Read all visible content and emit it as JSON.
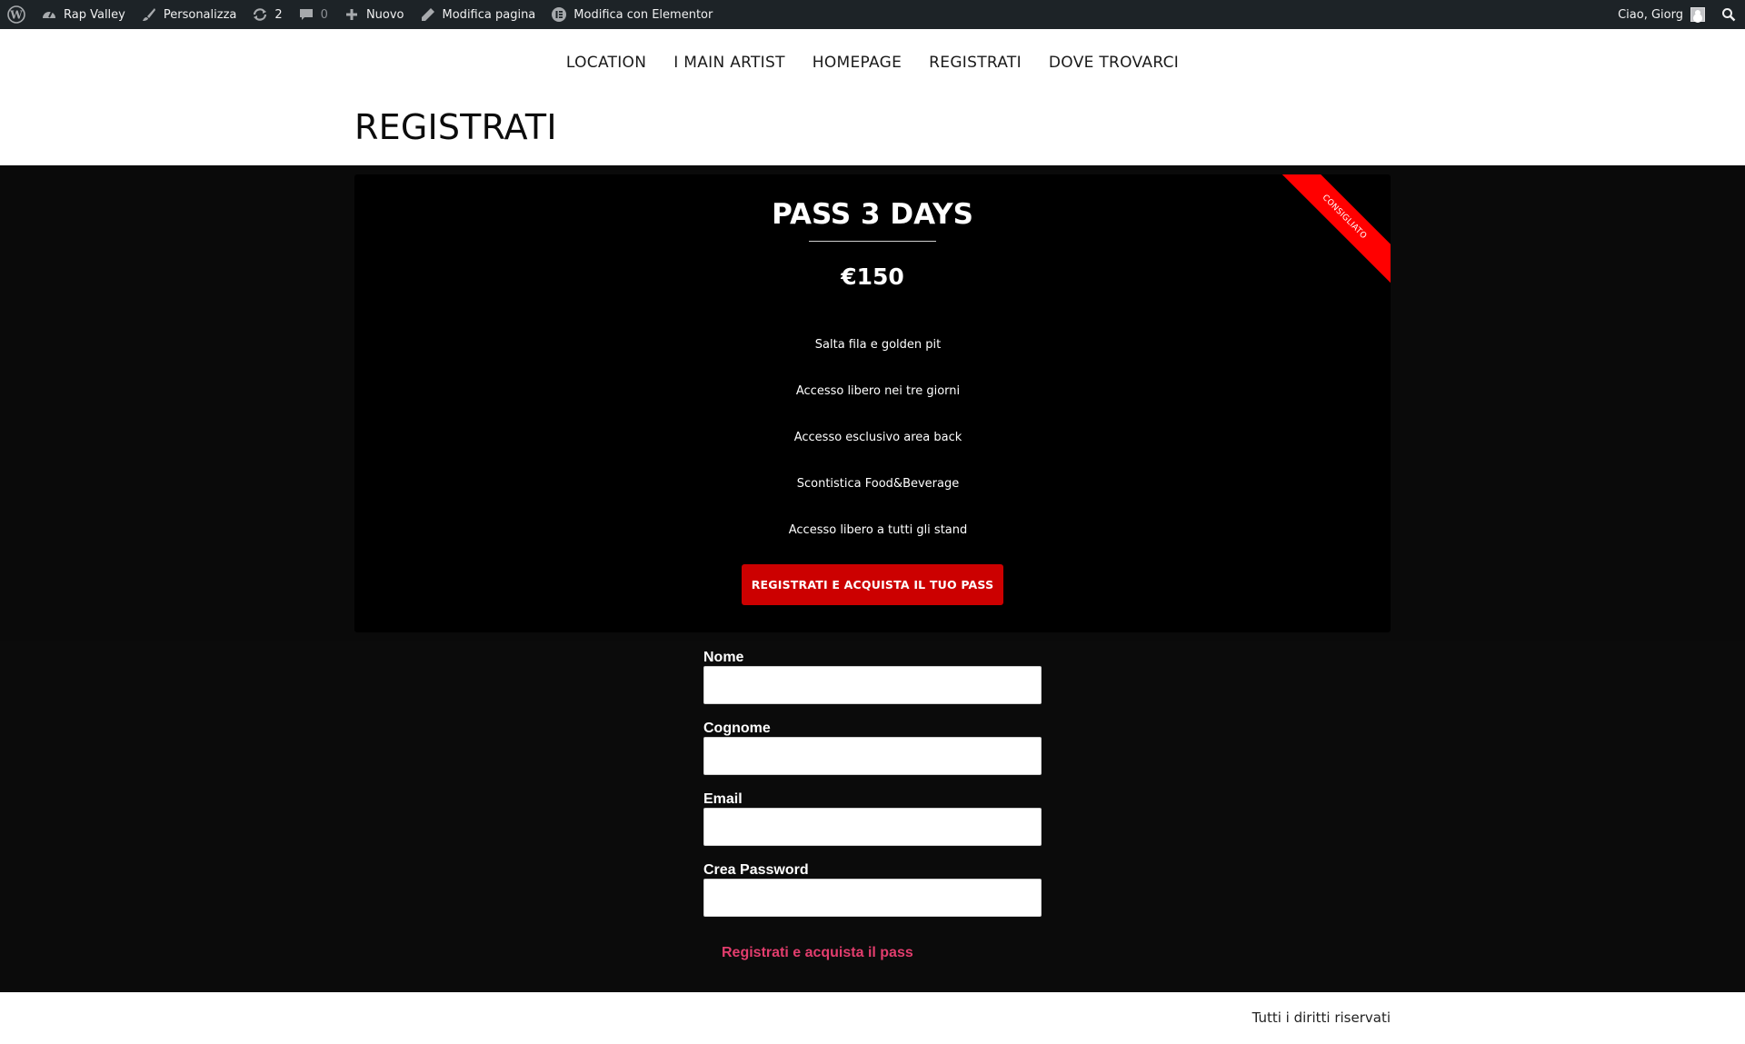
{
  "adminbar": {
    "wp_icon": "wordpress-logo-icon",
    "site_name": "Rap Valley",
    "customize": "Personalizza",
    "updates_count": "2",
    "comments_count": "0",
    "new": "Nuovo",
    "edit_page": "Modifica pagina",
    "edit_elementor": "Modifica con Elementor",
    "greeting": "Ciao, Giorg"
  },
  "nav": {
    "items": [
      "LOCATION",
      "I MAIN ARTIST",
      "HOMEPAGE",
      "REGISTRATI",
      "DOVE TROVARCI"
    ]
  },
  "page": {
    "title": "REGISTRATI"
  },
  "pricing": {
    "ribbon": "CONSIGLIATO",
    "title": "PASS 3 DAYS",
    "price": "€150",
    "features": [
      "Salta fila e golden pit",
      "Accesso libero nei tre giorni",
      "Accesso esclusivo area back",
      "Scontistica Food&Beverage",
      "Accesso libero a tutti gli stand"
    ],
    "button": "REGISTRATI E ACQUISTA IL TUO PASS"
  },
  "form": {
    "fields": [
      {
        "label": "Nome",
        "value": ""
      },
      {
        "label": "Cognome",
        "value": ""
      },
      {
        "label": "Email",
        "value": ""
      },
      {
        "label": "Crea Password",
        "value": ""
      }
    ],
    "submit": "Registrati e acquista il pass"
  },
  "footer": {
    "text": "Tutti i diritti riservati"
  },
  "colors": {
    "adminbar_bg": "#1d2327",
    "ribbon": "#ff0000",
    "button_red": "#cc0000",
    "link_pink": "#e23d6d"
  }
}
